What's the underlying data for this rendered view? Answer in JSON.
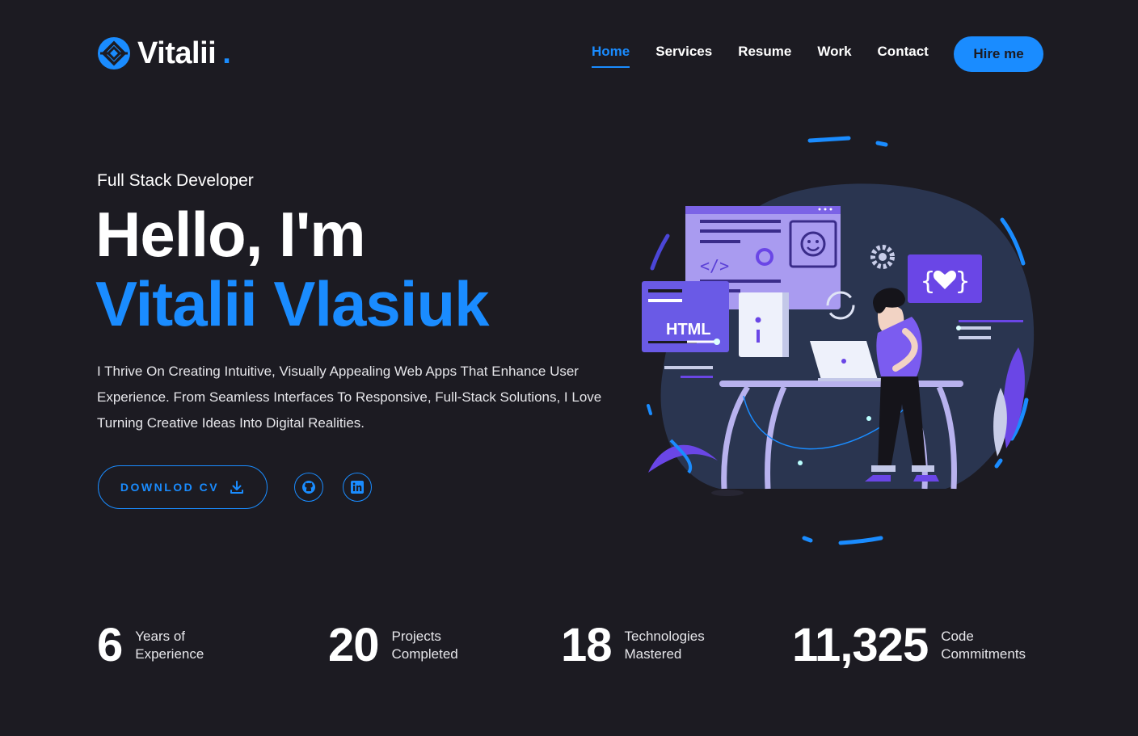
{
  "brand": {
    "name": "Vitalii",
    "dot": "."
  },
  "nav": {
    "items": [
      {
        "label": "Home",
        "active": true
      },
      {
        "label": "Services",
        "active": false
      },
      {
        "label": "Resume",
        "active": false
      },
      {
        "label": "Work",
        "active": false
      },
      {
        "label": "Contact",
        "active": false
      }
    ],
    "hire_label": "Hire me"
  },
  "hero": {
    "subtitle": "Full Stack Developer",
    "greeting": "Hello, I'm",
    "name": "Vitalii Vlasiuk",
    "description": "I Thrive On Creating Intuitive, Visually Appealing Web Apps That Enhance User Experience. From Seamless Interfaces To Responsive, Full-Stack Solutions, I Love Turning Creative Ideas Into Digital Realities.",
    "download_label": "DOWNLOD CV",
    "download_icon": "download-icon",
    "social": [
      {
        "icon": "github-icon"
      },
      {
        "icon": "linkedin-icon"
      }
    ]
  },
  "illustration": {
    "html_card_label": "HTML"
  },
  "stats": [
    {
      "number": "6",
      "label_line1": "Years of",
      "label_line2": "Experience"
    },
    {
      "number": "20",
      "label_line1": "Projects",
      "label_line2": "Completed"
    },
    {
      "number": "18",
      "label_line1": "Technologies",
      "label_line2": "Mastered"
    },
    {
      "number": "11,325",
      "label_line1": "Code",
      "label_line2": "Commitments"
    }
  ],
  "colors": {
    "accent": "#1a8cff",
    "background": "#1c1b22",
    "text": "#ffffff",
    "purple": "#7b5cf0"
  }
}
